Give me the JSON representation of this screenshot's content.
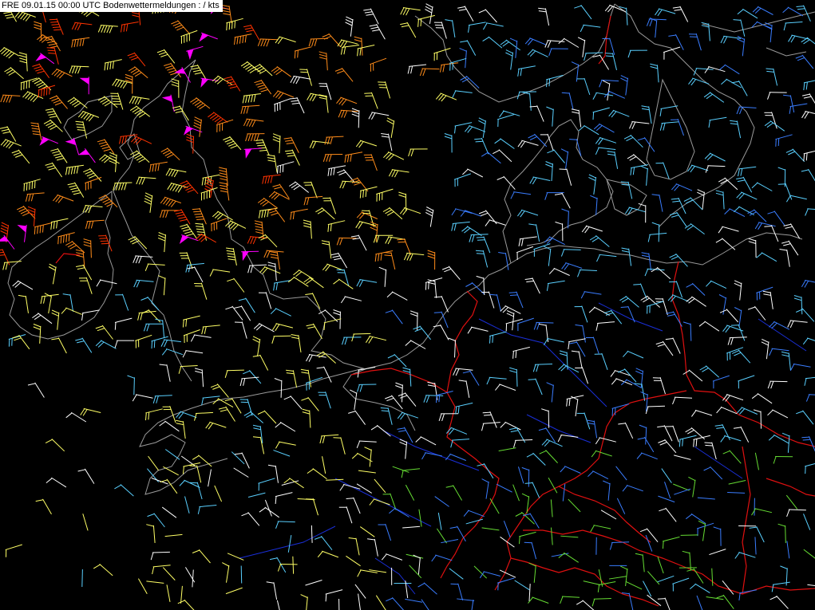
{
  "header": {
    "title": "FRE 09.01.15 00:00 UTC  Bodenwettermeldungen :  / kts"
  },
  "legend_colors": {
    "lt10": "#3a7dff",
    "10to15": "#5ad0ff",
    "15to20": "#ffffff",
    "20to25": "#ffff66",
    "25to30": "#ffcc33",
    "30to40": "#ff8c1a",
    "40to50": "#ff3300",
    "gt50": "#ff00ff",
    "calm": "#66dd33"
  },
  "map_colors": {
    "coast": "#9a9a9a",
    "border": "#e01010",
    "river": "#1a2fd8",
    "background": "#000000"
  }
}
